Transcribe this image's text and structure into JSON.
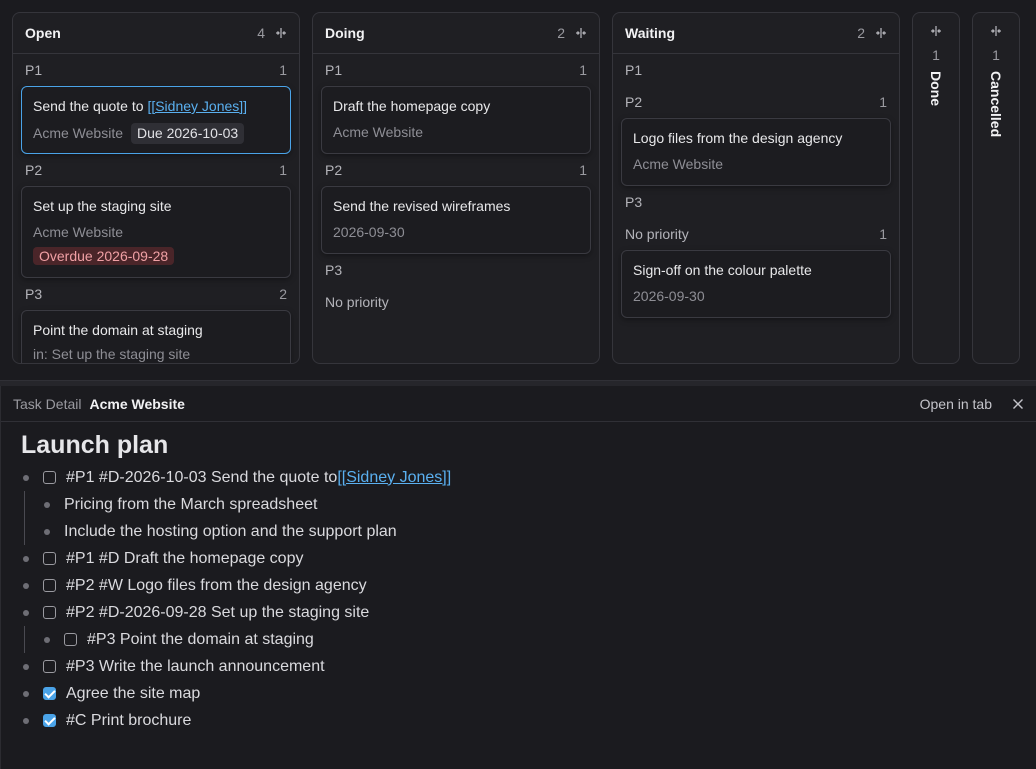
{
  "board": {
    "columns": [
      {
        "title": "Open",
        "count": "4",
        "groups": [
          {
            "label": "P1",
            "count": "1",
            "cards": [
              {
                "title_prefix": "Send the quote to ",
                "title_link": "[[Sidney Jones]]",
                "project": "Acme Website",
                "due": "Due 2026-10-03",
                "selected": true
              }
            ]
          },
          {
            "label": "P2",
            "count": "1",
            "cards": [
              {
                "title": "Set up the staging site",
                "project": "Acme Website",
                "overdue": "Overdue 2026-09-28"
              }
            ]
          },
          {
            "label": "P3",
            "count": "2",
            "cards": [
              {
                "title": "Point the domain at staging",
                "parent": "in: Set up the staging site"
              }
            ]
          }
        ]
      },
      {
        "title": "Doing",
        "count": "2",
        "groups": [
          {
            "label": "P1",
            "count": "1",
            "cards": [
              {
                "title": "Draft the homepage copy",
                "project": "Acme Website"
              }
            ]
          },
          {
            "label": "P2",
            "count": "1",
            "cards": [
              {
                "title": "Send the revised wireframes",
                "date": "2026-09-30"
              }
            ]
          },
          {
            "label": "P3",
            "count": ""
          },
          {
            "label": "No priority",
            "count": ""
          }
        ]
      },
      {
        "title": "Waiting",
        "count": "2",
        "groups": [
          {
            "label": "P1",
            "count": ""
          },
          {
            "label": "P2",
            "count": "1",
            "cards": [
              {
                "title": "Logo files from the design agency",
                "project": "Acme Website"
              }
            ]
          },
          {
            "label": "P3",
            "count": ""
          },
          {
            "label": "No priority",
            "count": "1",
            "cards": [
              {
                "title": "Sign-off on the colour palette",
                "date": "2026-09-30"
              }
            ]
          }
        ]
      },
      {
        "title": "Done",
        "count": "1"
      },
      {
        "title": "Cancelled",
        "count": "1"
      }
    ]
  },
  "detail": {
    "tab_label": "Task Detail",
    "tab_title": "Acme Website",
    "open_in_tab": "Open in tab",
    "doc_title": "Launch plan",
    "lines": [
      {
        "text": "#P1 #D-2026-10-03 Send the quote to ",
        "link": "[[Sidney Jones]]",
        "checkbox": true,
        "checked": false
      },
      {
        "text": "Pricing from the March spreadsheet"
      },
      {
        "text": "Include the hosting option and the support plan"
      },
      {
        "text": "#P1 #D Draft the homepage copy",
        "checkbox": true,
        "checked": false
      },
      {
        "text": "#P2 #W Logo files from the design agency",
        "checkbox": true,
        "checked": false
      },
      {
        "text": "#P2 #D-2026-09-28 Set up the staging site",
        "checkbox": true,
        "checked": false
      },
      {
        "text": "#P3 Point the domain at staging",
        "checkbox": true,
        "checked": false
      },
      {
        "text": "#P3 Write the launch announcement",
        "checkbox": true,
        "checked": false
      },
      {
        "text": "Agree the site map",
        "checkbox": true,
        "checked": true
      },
      {
        "text": "#C Print brochure",
        "checkbox": true,
        "checked": true
      }
    ]
  },
  "colors": {
    "accent": "#4aa3e8",
    "link": "#5ab0f0",
    "overdue_bg": "#4a2529",
    "overdue_text": "#f0a0a5"
  },
  "icons": {
    "collapse": "collapse-columns-icon",
    "close": "close-icon"
  }
}
